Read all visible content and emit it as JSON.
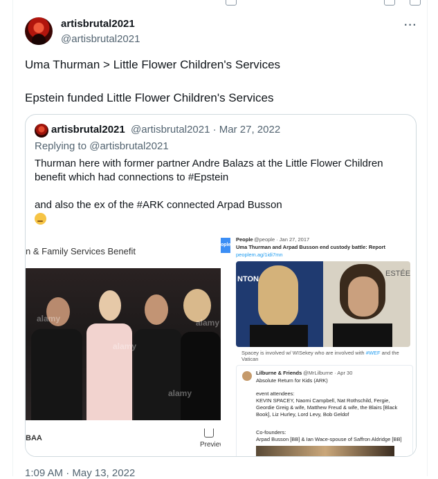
{
  "author": {
    "name": "artisbrutal2021",
    "handle": "@artisbrutal2021"
  },
  "tweet_lines": [
    "Uma Thurman > Little Flower Children's Services",
    "Epstein funded Little Flower Children's Services"
  ],
  "quoted": {
    "name": "artisbrutal2021",
    "handle_date": "@artisbrutal2021 · Mar 27, 2022",
    "replying": "Replying to @artisbrutal2021",
    "line1": "Thurman here with former partner Andre Balazs at the Little Flower Children",
    "line2": "benefit which had connections to #Epstein",
    "line3": "and also the ex of the #ARK connected Arpad Busson",
    "left_image": {
      "header": "n & Family Services Benefit",
      "watermark": "alamy",
      "footer": "BAA",
      "preview": "Preview"
    },
    "right_image": {
      "badge": "ople",
      "people_name": "People",
      "people_meta": "@people · Jan 27, 2017",
      "headline": "Uma Thurman and Arpad Busson end custody battle: Report",
      "link": "peoplem.ag/1idi7mn",
      "photo_text_left": "NTON C   TIZEN",
      "photo_text_right": "ESTÉE",
      "caption": "Spacey is involved w/ WISekey who are involved with",
      "caption_link": "#WEF",
      "caption_end": "and the Vatican",
      "card_name": "Lilburne & Friends",
      "card_meta": "@MrLilburne · Apr 30",
      "card_title": "Absolute Return for Kids (ARK)",
      "card_attendees_label": "event attendees:",
      "card_attendees": "KEVIN SPACEY, Naomi Campbell, Nat Rothschild, Fergie, Geordie Greig & wife, Matthew Freud & wife, the Blairs [Black Book], Liz Hurley, Lord Levy, Bob Geldof",
      "card_cofounders_label": "Co-founders:",
      "card_cofounders": "Arpad Busson [BB] & Ian Wace-spouse of Saffron Aldridge [BB]"
    }
  },
  "timestamp": "1:09 AM · May 13, 2022",
  "more_label": "···"
}
